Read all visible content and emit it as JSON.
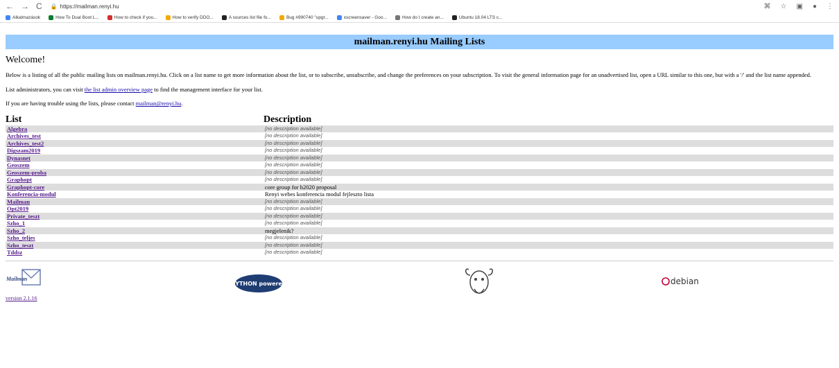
{
  "browser": {
    "url": "https://mailman.renyi.hu",
    "bookmarks": [
      {
        "label": "Alkalmazások",
        "color": "#4285f4"
      },
      {
        "label": "How To Dual Boot L...",
        "color": "#0a7d2f"
      },
      {
        "label": "How to check if you...",
        "color": "#d32f2f"
      },
      {
        "label": "How to verify DDO...",
        "color": "#f2a900"
      },
      {
        "label": "A sources list file fo...",
        "color": "#222222"
      },
      {
        "label": "Bug #990740 \"upgr...",
        "color": "#f2a900"
      },
      {
        "label": "xscreensaver - Goo...",
        "color": "#4285f4"
      },
      {
        "label": "How do I create an...",
        "color": "#777777"
      },
      {
        "label": "Ubuntu 18.04 LTS c...",
        "color": "#222222"
      }
    ]
  },
  "page": {
    "banner": "mailman.renyi.hu Mailing Lists",
    "welcome": "Welcome!",
    "intro": "Below is a listing of all the public mailing lists on mailman.renyi.hu. Click on a list name to get more information about the list, or to subscribe, unsubscribe, and change the preferences on your subscription. To visit the general information page for an unadvertised list, open a URL similar to this one, but with a '/' and the list name appended.",
    "admin_prefix": "List administrators, you can visit ",
    "admin_link": "the list admin overview page",
    "admin_suffix": " to find the management interface for your list.",
    "trouble_prefix": "If you are having trouble using the lists, please contact ",
    "trouble_link": "mailman@renyi.hu",
    "trouble_suffix": ".",
    "col_list": "List",
    "col_desc": "Description",
    "lists": [
      {
        "name": "Algebra",
        "desc": "[no description available]",
        "na": true
      },
      {
        "name": "Archives_test",
        "desc": "[no description available]",
        "na": true
      },
      {
        "name": "Archives_test2",
        "desc": "[no description available]",
        "na": true
      },
      {
        "name": "Digszam2019",
        "desc": "[no description available]",
        "na": true
      },
      {
        "name": "Dynasnet",
        "desc": "[no description available]",
        "na": true
      },
      {
        "name": "Geoszem",
        "desc": "[no description available]",
        "na": true
      },
      {
        "name": "Geoszem-proba",
        "desc": "[no description available]",
        "na": true
      },
      {
        "name": "Graphopt",
        "desc": "[no description available]",
        "na": true
      },
      {
        "name": "Graphopt-core",
        "desc": "core group for h2020 proposal",
        "na": false
      },
      {
        "name": "Konferencia-modul",
        "desc": "Renyi webes konferencia modul fejleszto lista",
        "na": false
      },
      {
        "name": "Mailman",
        "desc": "[no description available]",
        "na": true
      },
      {
        "name": "Opt2019",
        "desc": "[no description available]",
        "na": true
      },
      {
        "name": "Private_teszt",
        "desc": "[no description available]",
        "na": true
      },
      {
        "name": "Szho_1",
        "desc": "[no description available]",
        "na": true
      },
      {
        "name": "Szho_2",
        "desc": "megjelenik?",
        "na": false
      },
      {
        "name": "Szho_teljes",
        "desc": "[no description available]",
        "na": true
      },
      {
        "name": "Szho_teszt",
        "desc": "[no description available]",
        "na": true
      },
      {
        "name": "Tddsz",
        "desc": "[no description available]",
        "na": true
      }
    ],
    "footer": {
      "mailman_logo": "Mailman",
      "version": "version 2.1.16",
      "python_logo": "PYTHON powered",
      "debian_logo": "debian"
    }
  }
}
